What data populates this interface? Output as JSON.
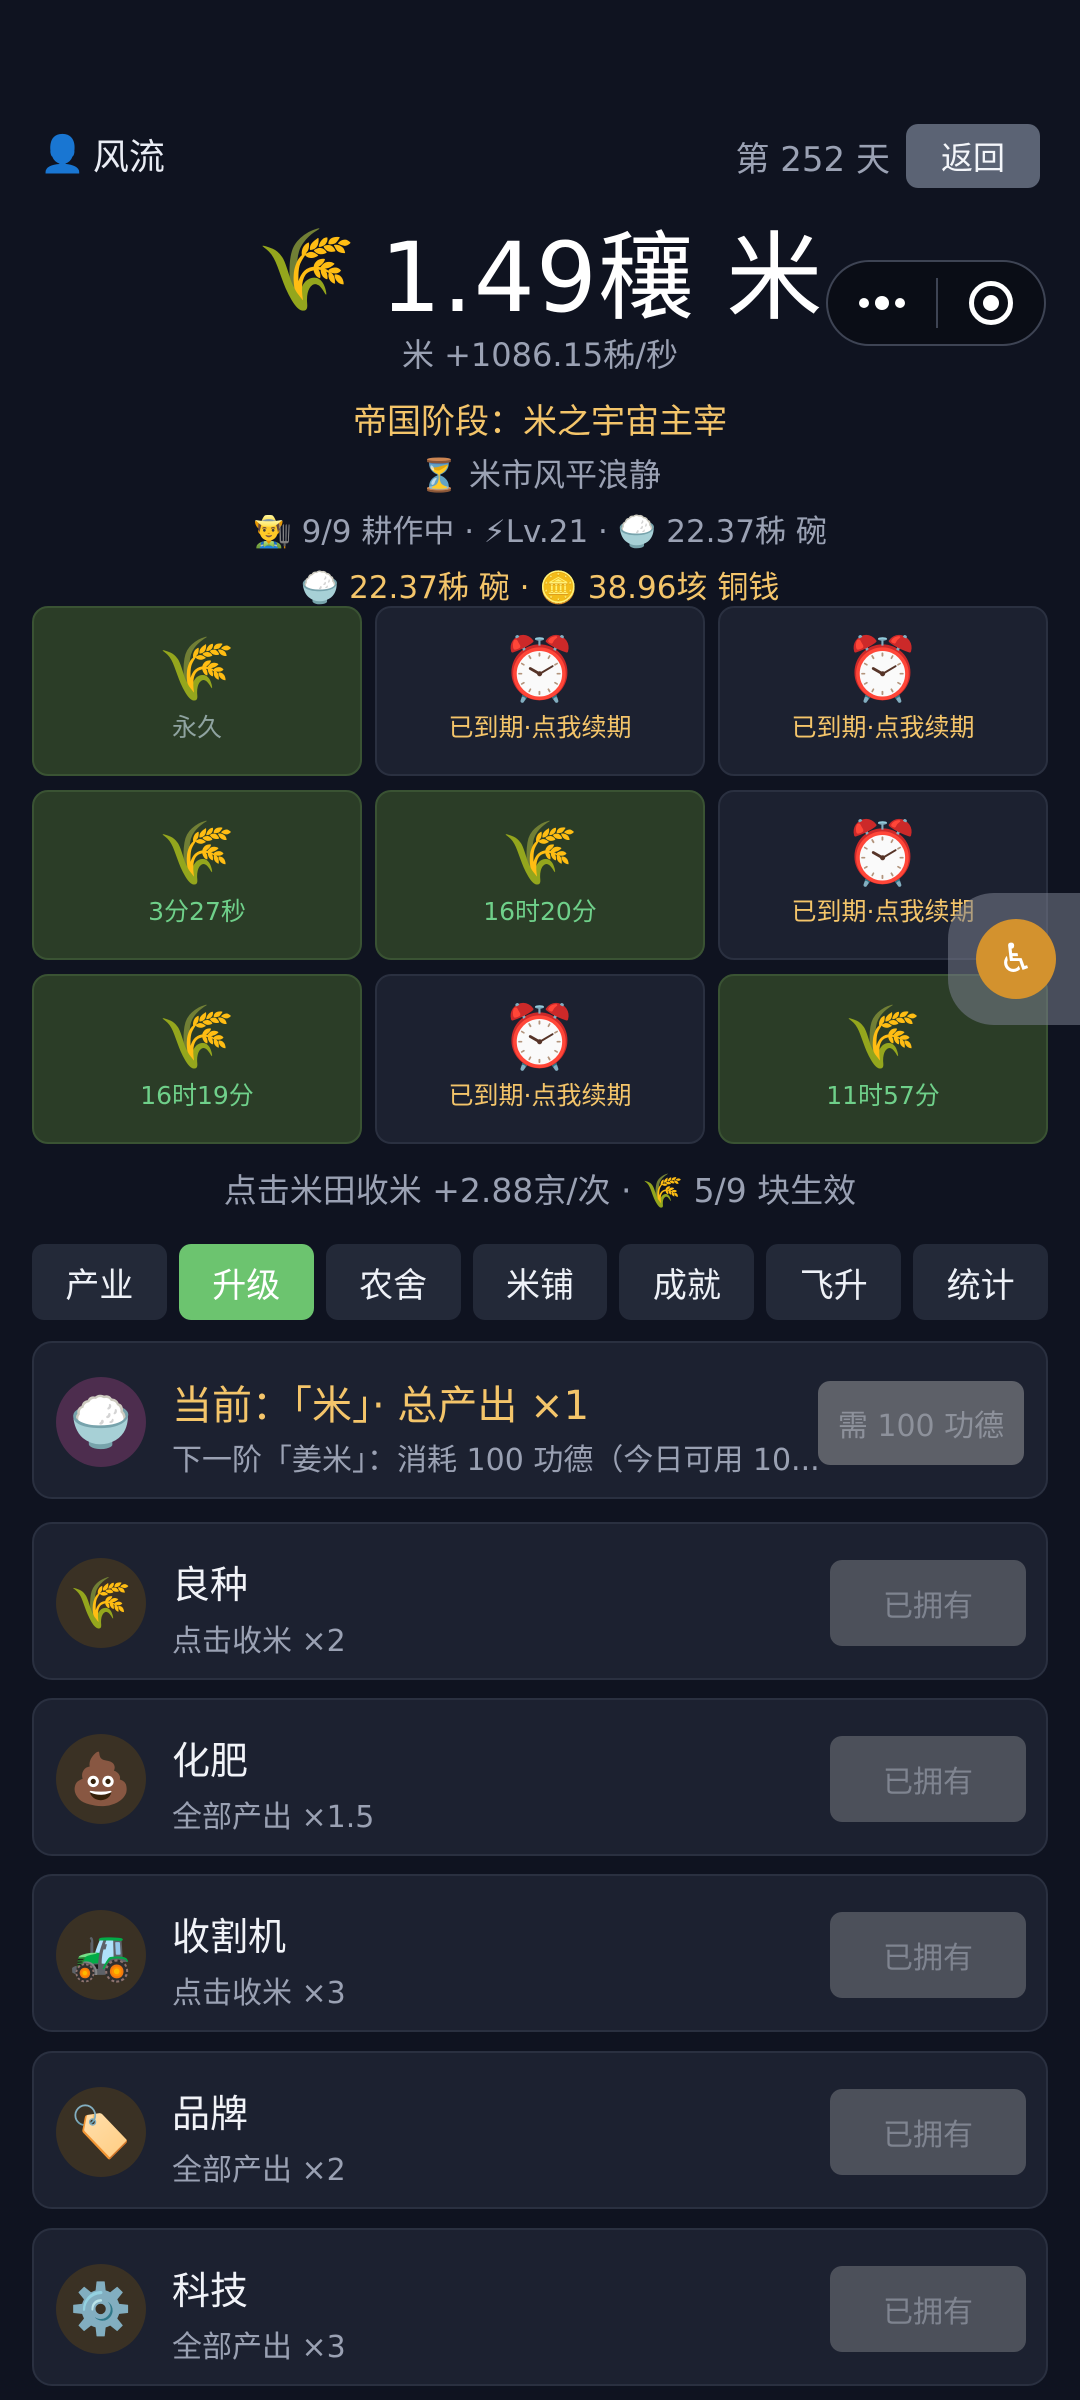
{
  "header": {
    "user_icon": "👤",
    "username": "风流",
    "day": "第 252 天",
    "back_label": "返回"
  },
  "stats": {
    "rice_icon": "🌾",
    "amount": "1.49穰 米",
    "rate": "米 +1086.15秭/秒",
    "stage": "帝国阶段：米之宇宙主宰",
    "market": "⏳ 米市风平浪静",
    "status_line": "👨‍🌾 9/9 耕作中 · ⚡Lv.21 · 🍚 22.37秭 碗",
    "wallet_line": "🍚 22.37秭 碗 · 🪙 38.96垓 铜钱"
  },
  "plots": [
    {
      "icon": "🌾",
      "label": "永久",
      "state": "permanent"
    },
    {
      "icon": "⏰",
      "label": "已到期·点我续期",
      "state": "expired"
    },
    {
      "icon": "⏰",
      "label": "已到期·点我续期",
      "state": "expired"
    },
    {
      "icon": "🌾",
      "label": "3分27秒",
      "state": "active"
    },
    {
      "icon": "🌾",
      "label": "16时20分",
      "state": "active"
    },
    {
      "icon": "⏰",
      "label": "已到期·点我续期",
      "state": "expired"
    },
    {
      "icon": "🌾",
      "label": "16时19分",
      "state": "active"
    },
    {
      "icon": "⏰",
      "label": "已到期·点我续期",
      "state": "expired"
    },
    {
      "icon": "🌾",
      "label": "11时57分",
      "state": "active"
    }
  ],
  "harvest_hint": "点击米田收米 +2.88京/次 · 🌾 5/9 块生效",
  "tabs": [
    {
      "label": "产业",
      "active": false
    },
    {
      "label": "升级",
      "active": true
    },
    {
      "label": "农舍",
      "active": false
    },
    {
      "label": "米铺",
      "active": false
    },
    {
      "label": "成就",
      "active": false
    },
    {
      "label": "飞升",
      "active": false
    },
    {
      "label": "统计",
      "active": false
    }
  ],
  "current_upgrade": {
    "icon": "🍚",
    "title": "当前：「米」· 总产出 ×1",
    "subtitle": "下一阶「姜米」：消耗 100 功德（今日可用 10...",
    "button": "需 100 功德"
  },
  "upgrades": [
    {
      "icon": "🌾",
      "name": "良种",
      "desc": "点击收米 ×2",
      "button": "已拥有"
    },
    {
      "icon": "💩",
      "name": "化肥",
      "desc": "全部产出 ×1.5",
      "button": "已拥有"
    },
    {
      "icon": "🚜",
      "name": "收割机",
      "desc": "点击收米 ×3",
      "button": "已拥有"
    },
    {
      "icon": "🏷️",
      "name": "品牌",
      "desc": "全部产出 ×2",
      "button": "已拥有"
    },
    {
      "icon": "⚙️",
      "name": "科技",
      "desc": "全部产出 ×3",
      "button": "已拥有"
    }
  ]
}
